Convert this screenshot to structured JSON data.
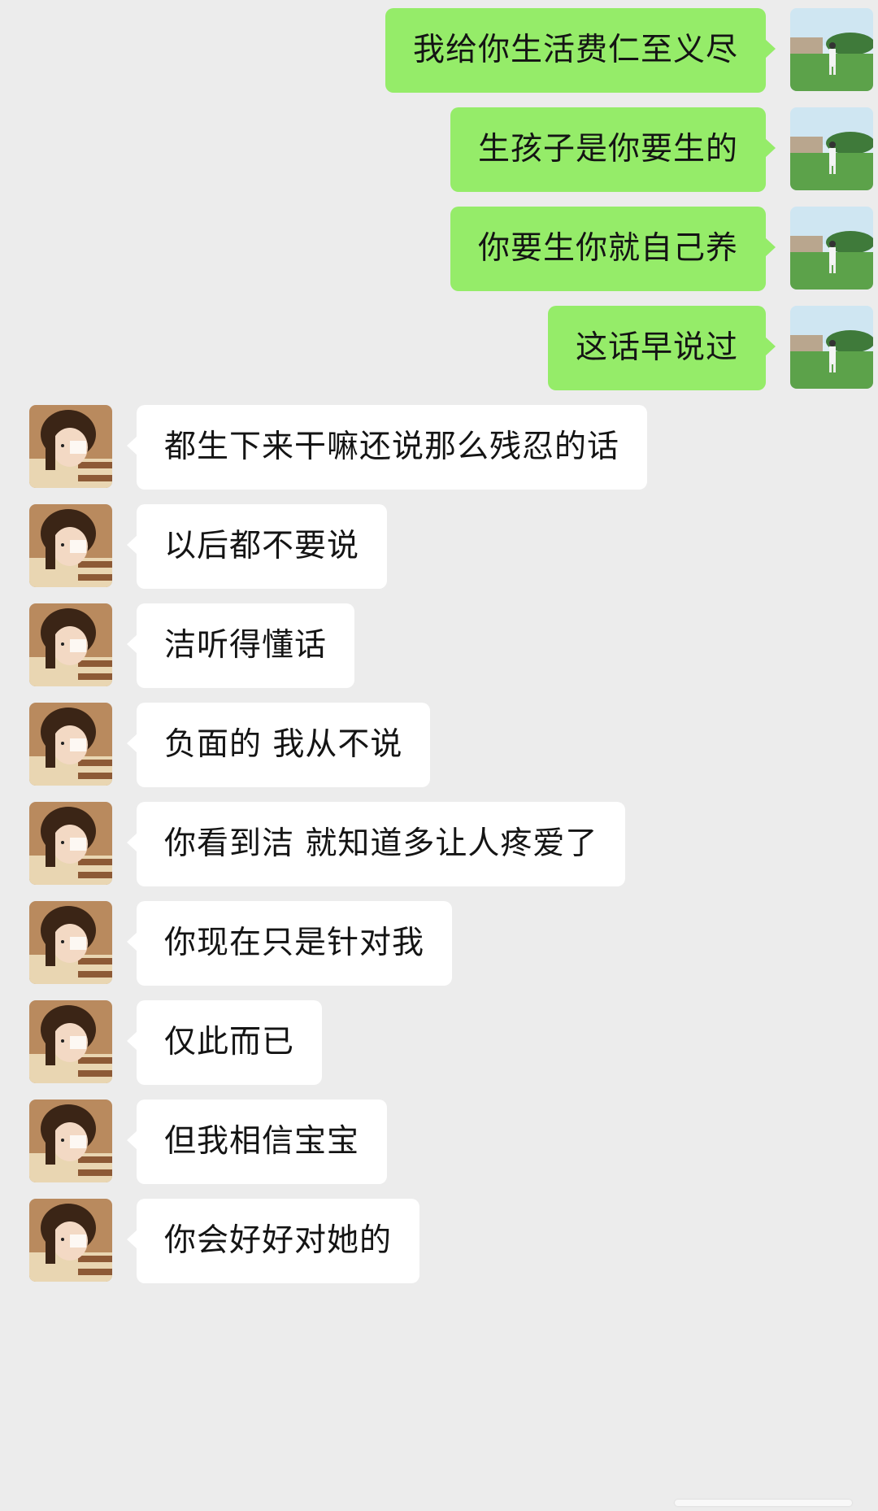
{
  "chat": {
    "messages": [
      {
        "direction": "out",
        "avatar": "self-avatar-icon",
        "text": "我给你生活费仁至义尽"
      },
      {
        "direction": "out",
        "avatar": "self-avatar-icon",
        "text": "生孩子是你要生的"
      },
      {
        "direction": "out",
        "avatar": "self-avatar-icon",
        "text": "你要生你就自己养"
      },
      {
        "direction": "out",
        "avatar": "self-avatar-icon",
        "text": "这话早说过"
      },
      {
        "direction": "in",
        "avatar": "contact-avatar-icon",
        "text": "都生下来干嘛还说那么残忍的话"
      },
      {
        "direction": "in",
        "avatar": "contact-avatar-icon",
        "text": "以后都不要说"
      },
      {
        "direction": "in",
        "avatar": "contact-avatar-icon",
        "text": "洁听得懂话"
      },
      {
        "direction": "in",
        "avatar": "contact-avatar-icon",
        "text": "负面的 我从不说"
      },
      {
        "direction": "in",
        "avatar": "contact-avatar-icon",
        "text": "你看到洁 就知道多让人疼爱了"
      },
      {
        "direction": "in",
        "avatar": "contact-avatar-icon",
        "text": "你现在只是针对我"
      },
      {
        "direction": "in",
        "avatar": "contact-avatar-icon",
        "text": "仅此而已"
      },
      {
        "direction": "in",
        "avatar": "contact-avatar-icon",
        "text": "但我相信宝宝"
      },
      {
        "direction": "in",
        "avatar": "contact-avatar-icon",
        "text": "你会好好对她的"
      }
    ]
  },
  "colors": {
    "background": "#ececec",
    "outgoing_bubble": "#95ec69",
    "incoming_bubble": "#ffffff",
    "text": "#141414"
  }
}
